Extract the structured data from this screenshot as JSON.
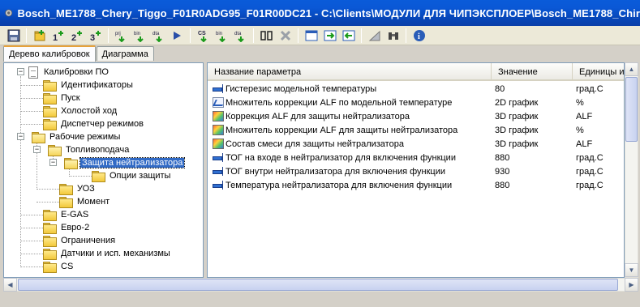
{
  "window": {
    "title": "Bosch_ME1788_Chery_Tiggo_F01R0ADG95_F01R00DC21 - C:\\Clients\\МОДУЛИ ДЛЯ ЧИПЭКСПЛОЕР\\Bosch_ME1788_Chir"
  },
  "toolbar": {
    "buttons": [
      "save-icon",
      "add-folder-icon",
      "add-1d-icon",
      "add-2d-icon",
      "add-3d-icon",
      "pr-bin-icon",
      "bin-icon",
      "dta-icon",
      "export-icon",
      "cs-icon",
      "bin2-icon",
      "dta2-icon",
      "compare-icon",
      "delete-icon",
      "window-icon",
      "move-right-icon",
      "move-left-icon",
      "chart-icon",
      "binoculars-icon",
      "info-icon"
    ]
  },
  "tabs": [
    {
      "label": "Дерево калибровок",
      "active": true
    },
    {
      "label": "Диаграмма",
      "active": false
    }
  ],
  "tree": {
    "root": "Калибровки ПО",
    "items": [
      {
        "label": "Идентификаторы"
      },
      {
        "label": "Пуск"
      },
      {
        "label": "Холостой ход"
      },
      {
        "label": "Диспетчер режимов"
      },
      {
        "label": "Рабочие режимы"
      },
      {
        "label": "Топливоподача"
      },
      {
        "label": "Защита нейтрализатора"
      },
      {
        "label": "Опции защиты"
      },
      {
        "label": "УОЗ"
      },
      {
        "label": "Момент"
      },
      {
        "label": "E-GAS"
      },
      {
        "label": "Евро-2"
      },
      {
        "label": "Ограничения"
      },
      {
        "label": "Датчики и исп. механизмы"
      },
      {
        "label": "CS"
      }
    ]
  },
  "grid": {
    "columns": [
      "Название параметра",
      "Значение",
      "Единицы из"
    ],
    "rows": [
      {
        "icon": "scalar",
        "name": "Гистерезис модельной температуры",
        "value": "80",
        "unit": "град.С"
      },
      {
        "icon": "2d",
        "name": "Множитель коррекции ALF по модельной температуре",
        "value": "2D график",
        "unit": "%"
      },
      {
        "icon": "3d",
        "name": "Коррекция ALF для защиты нейтрализатора",
        "value": "3D график",
        "unit": "ALF"
      },
      {
        "icon": "3d",
        "name": "Множитель коррекции ALF для защиты нейтрализатора",
        "value": "3D график",
        "unit": "%"
      },
      {
        "icon": "3d",
        "name": "Состав смеси для защиты нейтрализатора",
        "value": "3D график",
        "unit": "ALF"
      },
      {
        "icon": "scalar",
        "name": "ТОГ на входе в нейтрализатор для включения функции",
        "value": "880",
        "unit": "град.С"
      },
      {
        "icon": "scalar",
        "name": "ТОГ внутри нейтрализатора для включения функции",
        "value": "930",
        "unit": "град.С"
      },
      {
        "icon": "scalar",
        "name": "Температура нейтрализатора для включения функции",
        "value": "880",
        "unit": "град.С"
      }
    ]
  }
}
